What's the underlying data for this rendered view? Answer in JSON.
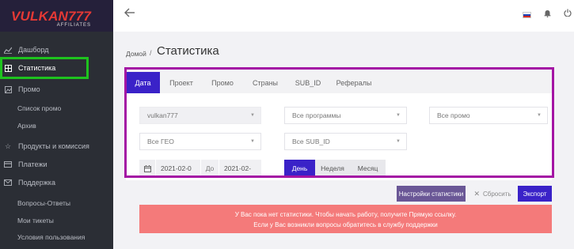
{
  "brand": {
    "name": "VULKAN777",
    "sub": "AFFILIATES"
  },
  "sidebar": {
    "items": [
      {
        "label": "Дашборд",
        "icon": "chart-line-icon"
      },
      {
        "label": "Статистика",
        "icon": "table-icon",
        "active": true
      },
      {
        "label": "Промо",
        "icon": "image-icon"
      },
      {
        "label": "Список промо"
      },
      {
        "label": "Архив"
      },
      {
        "label": "Продукты и комиссия",
        "icon": "star-icon"
      },
      {
        "label": "Платежи",
        "icon": "card-icon"
      },
      {
        "label": "Поддержка",
        "icon": "mail-icon"
      },
      {
        "label": "Вопросы-Ответы"
      },
      {
        "label": "Мои тикеты"
      },
      {
        "label": "Условия пользования"
      }
    ]
  },
  "header": {
    "back_icon": "arrow-left-icon",
    "flag": "ru",
    "bell_icon": "bell-icon",
    "power_icon": "power-icon"
  },
  "breadcrumb": {
    "home": "Домой",
    "sep": "/"
  },
  "page": {
    "title": "Статистика"
  },
  "tabs": [
    "Дата",
    "Проект",
    "Промо",
    "Страны",
    "SUB_ID",
    "Рефералы"
  ],
  "filters": {
    "project": "vulkan777",
    "programs": "Все программы",
    "promo": "Все промо",
    "geo": "Все ГЕО",
    "subid": "Все SUB_ID"
  },
  "dates": {
    "from": "2021-02-0",
    "sep": "До",
    "to": "2021-02-"
  },
  "period": [
    "День",
    "Неделя",
    "Месяц"
  ],
  "actions": {
    "settings": "Настройки статистики",
    "reset": "Сбросить",
    "export": "Экспорт"
  },
  "alert": {
    "line1": "У Вас пока нет статистики. Чтобы начать работу, получите Прямую ссылку.",
    "line2": "Если у Вас возникли вопросы обратитесь в службу поддержки"
  },
  "colors": {
    "accent": "#3a22c8",
    "sidebar": "#2b2e35",
    "alert": "#f47a7a",
    "logo": "#e53935",
    "highlight_green": "#1ec21e",
    "highlight_purple": "#a415a4"
  }
}
